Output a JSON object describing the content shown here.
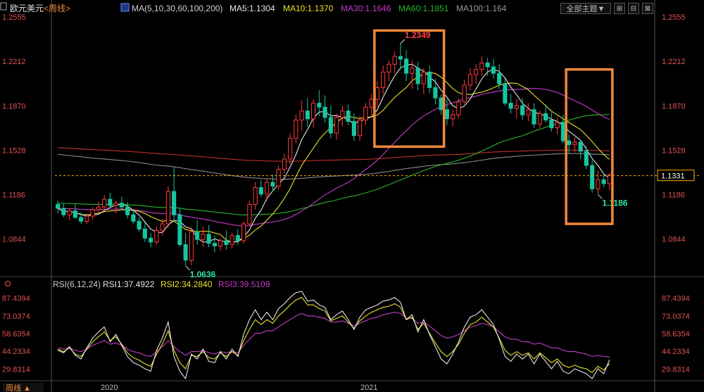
{
  "header": {
    "symbol": "欧元美元",
    "period": "<周线>",
    "ma_label": "MA(5,10,30,60,100,200)",
    "ma5": "MA5:1.1304",
    "ma10": "MA10:1.1370",
    "ma30": "MA30:1.1646",
    "ma60": "MA60:1.1851",
    "ma100": "MA100:1.164",
    "theme_button": "全部主题▼"
  },
  "rsi_header": {
    "label": "RSI(6,12,24)",
    "rsi1": "RSI1:37.4922",
    "rsi2": "RSI2:34.2840",
    "rsi3": "RSI3:39.5109"
  },
  "footer": {
    "period_button": "周线 ▲"
  },
  "colors": {
    "up": "#ff3b3b",
    "down": "#17c5a0",
    "ma5": "#e6e6e6",
    "ma10": "#e8e02a",
    "ma30": "#c23cc8",
    "ma60": "#29b52f",
    "ma100": "#8a8a8a",
    "ma200": "#c0302b",
    "highlight_box": "#f0883a",
    "label_red": "#ff4040",
    "label_green": "#2ee6a0",
    "current_price": "#ffb000"
  },
  "chart_data": [
    {
      "type": "candlestick",
      "title": "欧元美元 <周线>",
      "price_axis_ticks": [
        "1.2555",
        "1.2212",
        "1.1870",
        "1.1528",
        "1.1186",
        "1.0844"
      ],
      "ylim": [
        1.057,
        1.2555
      ],
      "time_labels": [
        "2020",
        "2021"
      ],
      "current_price": "1.1331",
      "annotations": [
        {
          "text": "1.2349",
          "type": "high"
        },
        {
          "text": "1.0636",
          "type": "low"
        },
        {
          "text": "1.1186",
          "type": "low"
        }
      ],
      "candles": [
        [
          1.111,
          1.114,
          1.104,
          1.108
        ],
        [
          1.108,
          1.112,
          1.101,
          1.103
        ],
        [
          1.103,
          1.108,
          1.099,
          1.106
        ],
        [
          1.106,
          1.111,
          1.1,
          1.101
        ],
        [
          1.101,
          1.105,
          1.096,
          1.098
        ],
        [
          1.098,
          1.104,
          1.096,
          1.102
        ],
        [
          1.102,
          1.109,
          1.099,
          1.107
        ],
        [
          1.107,
          1.113,
          1.104,
          1.109
        ],
        [
          1.109,
          1.118,
          1.106,
          1.115
        ],
        [
          1.115,
          1.12,
          1.108,
          1.11
        ],
        [
          1.11,
          1.114,
          1.104,
          1.112
        ],
        [
          1.112,
          1.117,
          1.107,
          1.109
        ],
        [
          1.109,
          1.113,
          1.1,
          1.103
        ],
        [
          1.103,
          1.107,
          1.096,
          1.098
        ],
        [
          1.098,
          1.101,
          1.09,
          1.092
        ],
        [
          1.092,
          1.097,
          1.082,
          1.085
        ],
        [
          1.085,
          1.089,
          1.078,
          1.082
        ],
        [
          1.082,
          1.094,
          1.08,
          1.091
        ],
        [
          1.091,
          1.1,
          1.087,
          1.096
        ],
        [
          1.096,
          1.125,
          1.093,
          1.121
        ],
        [
          1.121,
          1.14,
          1.098,
          1.103
        ],
        [
          1.103,
          1.108,
          1.078,
          1.08
        ],
        [
          1.08,
          1.089,
          1.064,
          1.068
        ],
        [
          1.068,
          1.093,
          1.064,
          1.09
        ],
        [
          1.09,
          1.099,
          1.08,
          1.084
        ],
        [
          1.084,
          1.094,
          1.078,
          1.088
        ],
        [
          1.088,
          1.095,
          1.078,
          1.081
        ],
        [
          1.081,
          1.087,
          1.074,
          1.079
        ],
        [
          1.079,
          1.085,
          1.075,
          1.083
        ],
        [
          1.083,
          1.091,
          1.076,
          1.08
        ],
        [
          1.08,
          1.089,
          1.077,
          1.087
        ],
        [
          1.087,
          1.092,
          1.08,
          1.083
        ],
        [
          1.083,
          1.098,
          1.081,
          1.096
        ],
        [
          1.096,
          1.114,
          1.094,
          1.111
        ],
        [
          1.111,
          1.128,
          1.107,
          1.124
        ],
        [
          1.124,
          1.13,
          1.117,
          1.119
        ],
        [
          1.119,
          1.131,
          1.114,
          1.128
        ],
        [
          1.128,
          1.134,
          1.121,
          1.125
        ],
        [
          1.125,
          1.141,
          1.122,
          1.138
        ],
        [
          1.138,
          1.15,
          1.135,
          1.146
        ],
        [
          1.146,
          1.166,
          1.142,
          1.162
        ],
        [
          1.162,
          1.18,
          1.158,
          1.176
        ],
        [
          1.176,
          1.191,
          1.168,
          1.183
        ],
        [
          1.183,
          1.193,
          1.171,
          1.177
        ],
        [
          1.177,
          1.192,
          1.17,
          1.189
        ],
        [
          1.189,
          1.199,
          1.179,
          1.186
        ],
        [
          1.186,
          1.195,
          1.174,
          1.178
        ],
        [
          1.178,
          1.187,
          1.162,
          1.166
        ],
        [
          1.166,
          1.181,
          1.161,
          1.178
        ],
        [
          1.178,
          1.187,
          1.171,
          1.183
        ],
        [
          1.183,
          1.188,
          1.172,
          1.175
        ],
        [
          1.175,
          1.181,
          1.16,
          1.164
        ],
        [
          1.164,
          1.179,
          1.16,
          1.176
        ],
        [
          1.176,
          1.189,
          1.172,
          1.186
        ],
        [
          1.186,
          1.196,
          1.18,
          1.192
        ],
        [
          1.192,
          1.206,
          1.186,
          1.201
        ],
        [
          1.201,
          1.218,
          1.196,
          1.213
        ],
        [
          1.213,
          1.222,
          1.206,
          1.219
        ],
        [
          1.219,
          1.229,
          1.212,
          1.225
        ],
        [
          1.225,
          1.235,
          1.215,
          1.223
        ],
        [
          1.223,
          1.23,
          1.206,
          1.212
        ],
        [
          1.212,
          1.222,
          1.2,
          1.216
        ],
        [
          1.216,
          1.221,
          1.199,
          1.204
        ],
        [
          1.204,
          1.216,
          1.196,
          1.213
        ],
        [
          1.213,
          1.218,
          1.197,
          1.201
        ],
        [
          1.201,
          1.208,
          1.188,
          1.193
        ],
        [
          1.193,
          1.196,
          1.18,
          1.184
        ],
        [
          1.184,
          1.192,
          1.172,
          1.177
        ],
        [
          1.177,
          1.184,
          1.171,
          1.18
        ],
        [
          1.18,
          1.193,
          1.177,
          1.19
        ],
        [
          1.19,
          1.207,
          1.188,
          1.203
        ],
        [
          1.203,
          1.216,
          1.199,
          1.211
        ],
        [
          1.211,
          1.219,
          1.204,
          1.215
        ],
        [
          1.215,
          1.225,
          1.21,
          1.22
        ],
        [
          1.22,
          1.224,
          1.21,
          1.217
        ],
        [
          1.217,
          1.223,
          1.208,
          1.212
        ],
        [
          1.212,
          1.219,
          1.2,
          1.204
        ],
        [
          1.204,
          1.208,
          1.187,
          1.189
        ],
        [
          1.189,
          1.196,
          1.181,
          1.185
        ],
        [
          1.185,
          1.192,
          1.177,
          1.187
        ],
        [
          1.187,
          1.193,
          1.176,
          1.18
        ],
        [
          1.18,
          1.189,
          1.175,
          1.184
        ],
        [
          1.184,
          1.189,
          1.17,
          1.173
        ],
        [
          1.173,
          1.183,
          1.17,
          1.181
        ],
        [
          1.181,
          1.188,
          1.174,
          1.176
        ],
        [
          1.176,
          1.182,
          1.167,
          1.17
        ],
        [
          1.17,
          1.178,
          1.165,
          1.174
        ],
        [
          1.174,
          1.18,
          1.158,
          1.16
        ],
        [
          1.16,
          1.165,
          1.15,
          1.157
        ],
        [
          1.157,
          1.163,
          1.151,
          1.159
        ],
        [
          1.159,
          1.161,
          1.146,
          1.152
        ],
        [
          1.152,
          1.156,
          1.138,
          1.141
        ],
        [
          1.141,
          1.145,
          1.12,
          1.123
        ],
        [
          1.123,
          1.137,
          1.119,
          1.13
        ],
        [
          1.13,
          1.135,
          1.124,
          1.127
        ],
        [
          1.127,
          1.135,
          1.122,
          1.134
        ]
      ]
    },
    {
      "type": "line",
      "title": "RSI(6,12,24)",
      "ylim": [
        22,
        93
      ],
      "y_ticks": [
        "87.4394",
        "73.0374",
        "58.6354",
        "44.2334",
        "29.8314"
      ],
      "series": [
        {
          "name": "RSI1",
          "color": "#e6e6e6",
          "values": [
            45,
            43,
            48,
            41,
            38,
            47,
            55,
            60,
            64,
            52,
            58,
            49,
            40,
            35,
            33,
            30,
            28,
            45,
            55,
            68,
            40,
            28,
            22,
            42,
            38,
            46,
            36,
            35,
            44,
            38,
            46,
            40,
            58,
            70,
            78,
            70,
            76,
            70,
            79,
            83,
            88,
            92,
            93,
            85,
            86,
            82,
            80,
            70,
            74,
            77,
            70,
            62,
            72,
            78,
            80,
            82,
            85,
            86,
            88,
            84,
            70,
            74,
            60,
            70,
            58,
            48,
            38,
            34,
            42,
            52,
            64,
            72,
            74,
            78,
            72,
            66,
            54,
            40,
            36,
            42,
            38,
            42,
            34,
            42,
            36,
            30,
            36,
            28,
            26,
            30,
            28,
            26,
            22,
            30,
            26,
            37.5
          ]
        },
        {
          "name": "RSI2",
          "color": "#e8e02a",
          "values": [
            46,
            44,
            47,
            42,
            40,
            46,
            52,
            56,
            60,
            53,
            56,
            50,
            43,
            39,
            37,
            34,
            32,
            42,
            50,
            61,
            45,
            35,
            30,
            41,
            40,
            44,
            39,
            38,
            43,
            40,
            44,
            41,
            53,
            62,
            70,
            66,
            70,
            67,
            73,
            77,
            82,
            86,
            88,
            82,
            82,
            79,
            77,
            69,
            71,
            73,
            68,
            63,
            69,
            73,
            76,
            78,
            80,
            81,
            83,
            80,
            70,
            72,
            62,
            67,
            59,
            51,
            44,
            40,
            44,
            50,
            59,
            66,
            68,
            72,
            68,
            64,
            55,
            45,
            41,
            44,
            41,
            43,
            38,
            43,
            39,
            35,
            38,
            33,
            31,
            33,
            31,
            30,
            27,
            32,
            29,
            34.3
          ]
        },
        {
          "name": "RSI3",
          "color": "#c23cc8",
          "values": [
            47,
            46,
            47,
            45,
            44,
            46,
            49,
            51,
            53,
            50,
            51,
            49,
            46,
            44,
            43,
            41,
            40,
            44,
            48,
            53,
            48,
            44,
            41,
            44,
            44,
            45,
            43,
            42,
            44,
            43,
            44,
            43,
            49,
            54,
            59,
            59,
            61,
            61,
            64,
            67,
            70,
            73,
            75,
            73,
            73,
            72,
            71,
            68,
            68,
            69,
            67,
            65,
            67,
            69,
            71,
            72,
            74,
            75,
            76,
            75,
            71,
            71,
            67,
            68,
            65,
            61,
            57,
            55,
            56,
            58,
            61,
            64,
            65,
            67,
            66,
            64,
            60,
            56,
            54,
            54,
            52,
            52,
            50,
            51,
            49,
            47,
            47,
            45,
            44,
            44,
            43,
            42,
            40,
            41,
            40,
            39.5
          ]
        }
      ]
    }
  ]
}
